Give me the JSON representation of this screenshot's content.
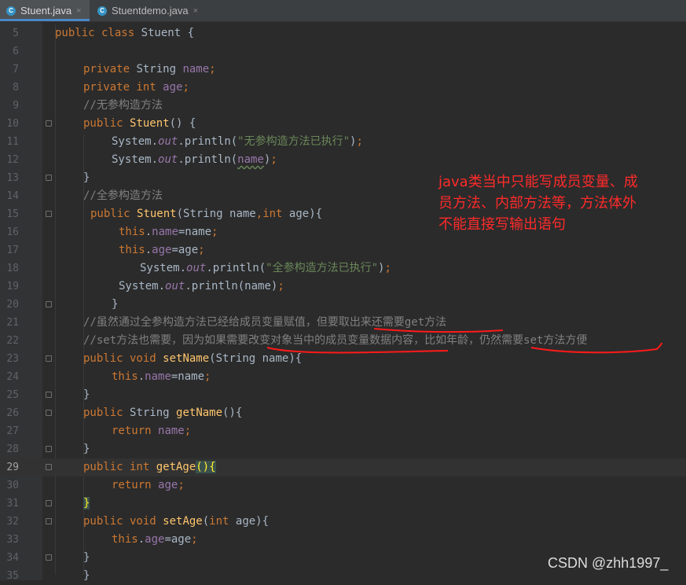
{
  "tabs": [
    {
      "label": "Stuent.java",
      "icon": "java-class-icon",
      "close": "×",
      "active": true
    },
    {
      "label": "Stuentdemo.java",
      "icon": "java-class-icon",
      "close": "×",
      "active": false
    }
  ],
  "editor": {
    "current_line": 29,
    "lines": [
      {
        "n": 5,
        "indent": 0,
        "parts": [
          [
            "k",
            "public class "
          ],
          [
            "p",
            "Stuent "
          ],
          [
            "p",
            "{"
          ]
        ]
      },
      {
        "n": 6,
        "indent": 0,
        "parts": []
      },
      {
        "n": 7,
        "indent": 4,
        "parts": [
          [
            "k",
            "private "
          ],
          [
            "p",
            "String "
          ],
          [
            "f",
            "name"
          ],
          [
            "k",
            ";"
          ]
        ]
      },
      {
        "n": 8,
        "indent": 4,
        "parts": [
          [
            "k",
            "private int "
          ],
          [
            "f",
            "age"
          ],
          [
            "k",
            ";"
          ]
        ]
      },
      {
        "n": 9,
        "indent": 4,
        "parts": [
          [
            "c",
            "//无参构造方法"
          ]
        ]
      },
      {
        "n": 10,
        "indent": 4,
        "fold": true,
        "parts": [
          [
            "k",
            "public "
          ],
          [
            "m",
            "Stuent"
          ],
          [
            "p",
            "() {"
          ]
        ]
      },
      {
        "n": 11,
        "indent": 8,
        "parts": [
          [
            "p",
            "System."
          ],
          [
            "fi",
            "out"
          ],
          [
            "p",
            ".println("
          ],
          [
            "s",
            "\"无参构造方法已执行\""
          ],
          [
            "p",
            ")"
          ],
          [
            "k",
            ";"
          ]
        ]
      },
      {
        "n": 12,
        "indent": 8,
        "parts": [
          [
            "p",
            "System."
          ],
          [
            "fi",
            "out"
          ],
          [
            "p",
            ".println("
          ],
          [
            "fu",
            "name"
          ],
          [
            "p",
            ")"
          ],
          [
            "k",
            ";"
          ]
        ]
      },
      {
        "n": 13,
        "indent": 4,
        "fold": true,
        "parts": [
          [
            "p",
            "}"
          ]
        ]
      },
      {
        "n": 14,
        "indent": 4,
        "parts": [
          [
            "c",
            "//全参构造方法"
          ]
        ]
      },
      {
        "n": 15,
        "indent": 5,
        "fold": true,
        "parts": [
          [
            "k",
            "public "
          ],
          [
            "m",
            "Stuent"
          ],
          [
            "p",
            "(String name"
          ],
          [
            "k",
            ","
          ],
          [
            "k",
            "int "
          ],
          [
            "p",
            "age){"
          ]
        ]
      },
      {
        "n": 16,
        "indent": 9,
        "parts": [
          [
            "k",
            "this"
          ],
          [
            "p",
            "."
          ],
          [
            "f",
            "name"
          ],
          [
            "p",
            "=name"
          ],
          [
            "k",
            ";"
          ]
        ]
      },
      {
        "n": 17,
        "indent": 9,
        "parts": [
          [
            "k",
            "this"
          ],
          [
            "p",
            "."
          ],
          [
            "f",
            "age"
          ],
          [
            "p",
            "=age"
          ],
          [
            "k",
            ";"
          ]
        ]
      },
      {
        "n": 18,
        "indent": 12,
        "parts": [
          [
            "p",
            "System."
          ],
          [
            "fi",
            "out"
          ],
          [
            "p",
            ".println("
          ],
          [
            "s",
            "\"全参构造方法已执行\""
          ],
          [
            "p",
            ")"
          ],
          [
            "k",
            ";"
          ]
        ]
      },
      {
        "n": 19,
        "indent": 9,
        "parts": [
          [
            "p",
            "System."
          ],
          [
            "fi",
            "out"
          ],
          [
            "p",
            ".println(name)"
          ],
          [
            "k",
            ";"
          ]
        ]
      },
      {
        "n": 20,
        "indent": 8,
        "fold": true,
        "parts": [
          [
            "p",
            "}"
          ]
        ]
      },
      {
        "n": 21,
        "indent": 4,
        "parts": [
          [
            "c",
            "//虽然通过全参构造方法已经给成员变量赋值，但要取出来还需要get方法"
          ]
        ]
      },
      {
        "n": 22,
        "indent": 4,
        "parts": [
          [
            "c",
            "//set方法也需要，因为如果需要改变对象当中的成员变量数据内容，比如年龄，仍然需要set方法方便"
          ]
        ]
      },
      {
        "n": 23,
        "indent": 4,
        "fold": true,
        "parts": [
          [
            "k",
            "public void "
          ],
          [
            "m",
            "setName"
          ],
          [
            "p",
            "(String name){"
          ]
        ]
      },
      {
        "n": 24,
        "indent": 8,
        "parts": [
          [
            "k",
            "this"
          ],
          [
            "p",
            "."
          ],
          [
            "f",
            "name"
          ],
          [
            "p",
            "=name"
          ],
          [
            "k",
            ";"
          ]
        ]
      },
      {
        "n": 25,
        "indent": 4,
        "fold": true,
        "parts": [
          [
            "p",
            "}"
          ]
        ]
      },
      {
        "n": 26,
        "indent": 4,
        "fold": true,
        "parts": [
          [
            "k",
            "public "
          ],
          [
            "p",
            "String "
          ],
          [
            "m",
            "getName"
          ],
          [
            "p",
            "(){"
          ]
        ]
      },
      {
        "n": 27,
        "indent": 8,
        "parts": [
          [
            "k",
            "return "
          ],
          [
            "f",
            "name"
          ],
          [
            "k",
            ";"
          ]
        ]
      },
      {
        "n": 28,
        "indent": 4,
        "fold": true,
        "parts": [
          [
            "p",
            "}"
          ]
        ]
      },
      {
        "n": 29,
        "indent": 4,
        "fold": true,
        "parts": [
          [
            "k",
            "public int "
          ],
          [
            "m",
            "getAge"
          ],
          [
            "bm",
            "()"
          ],
          [
            "bm",
            "{"
          ]
        ]
      },
      {
        "n": 30,
        "indent": 8,
        "parts": [
          [
            "k",
            "return "
          ],
          [
            "f",
            "age"
          ],
          [
            "k",
            ";"
          ]
        ]
      },
      {
        "n": 31,
        "indent": 4,
        "fold": true,
        "parts": [
          [
            "bm",
            "}"
          ]
        ]
      },
      {
        "n": 32,
        "indent": 4,
        "fold": true,
        "parts": [
          [
            "k",
            "public void "
          ],
          [
            "m",
            "setAge"
          ],
          [
            "p",
            "("
          ],
          [
            "k",
            "int "
          ],
          [
            "p",
            "age){"
          ]
        ]
      },
      {
        "n": 33,
        "indent": 8,
        "parts": [
          [
            "k",
            "this"
          ],
          [
            "p",
            "."
          ],
          [
            "f",
            "age"
          ],
          [
            "p",
            "=age"
          ],
          [
            "k",
            ";"
          ]
        ]
      },
      {
        "n": 34,
        "indent": 4,
        "fold": true,
        "parts": [
          [
            "p",
            "}"
          ]
        ]
      },
      {
        "n": 35,
        "indent": 4,
        "parts": [
          [
            "p",
            "}"
          ]
        ]
      }
    ]
  },
  "annotation": {
    "lines": [
      "java类当中只能写成员变量、成",
      "员方法、内部方法等，方法体外",
      "不能直接写输出语句"
    ],
    "color": "#ff2a2a"
  },
  "watermark": "CSDN @zhh1997_",
  "colors": {
    "keyword": "#cc7832",
    "field": "#9876aa",
    "string": "#6a8759",
    "comment": "#808080",
    "method": "#ffc66d",
    "plain": "#a9b7c6",
    "ink": "#ff1a1a",
    "background": "#2b2b2b"
  }
}
